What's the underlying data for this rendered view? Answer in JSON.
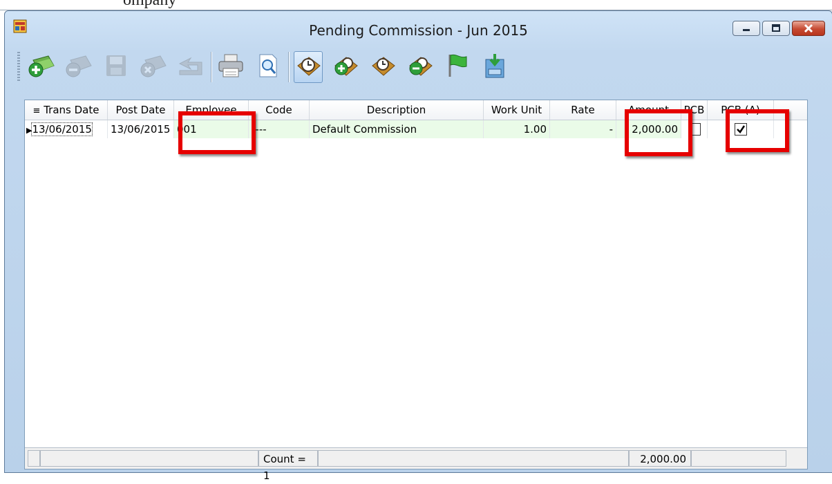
{
  "background_text": "ompany",
  "window": {
    "title": "Pending Commission - Jun 2015"
  },
  "toolbar": {
    "buttons": [
      {
        "name": "add-commission-icon",
        "state": "enabled"
      },
      {
        "name": "delete-commission-icon",
        "state": "disabled"
      },
      {
        "name": "save-icon",
        "state": "disabled"
      },
      {
        "name": "cancel-icon",
        "state": "disabled"
      },
      {
        "name": "undo-icon",
        "state": "disabled"
      },
      {
        "name": "print-icon",
        "state": "enabled"
      },
      {
        "name": "preview-icon",
        "state": "enabled"
      },
      {
        "name": "pending-commission-icon",
        "state": "active"
      },
      {
        "name": "add-pending-icon",
        "state": "enabled"
      },
      {
        "name": "edit-pending-icon",
        "state": "enabled"
      },
      {
        "name": "remove-pending-icon",
        "state": "enabled"
      },
      {
        "name": "flag-icon",
        "state": "enabled"
      },
      {
        "name": "archive-icon",
        "state": "enabled"
      }
    ]
  },
  "grid": {
    "columns": [
      "Trans Date",
      "Post Date",
      "Employee",
      "Code",
      "Description",
      "Work Unit",
      "Rate",
      "Amount",
      "PCB",
      "PCB (A)"
    ],
    "rows": [
      {
        "trans_date": "13/06/2015",
        "post_date": "13/06/2015",
        "employee": "001",
        "code": "----",
        "description": "Default Commission",
        "work_unit": "1.00",
        "rate": "-",
        "amount": "2,000.00",
        "pcb": false,
        "pcb_a": true
      }
    ],
    "footer": {
      "count": "Count = 1",
      "total_amount": "2,000.00"
    }
  },
  "colors": {
    "highlight": "#e60000",
    "row_green": "#eafbe8"
  }
}
